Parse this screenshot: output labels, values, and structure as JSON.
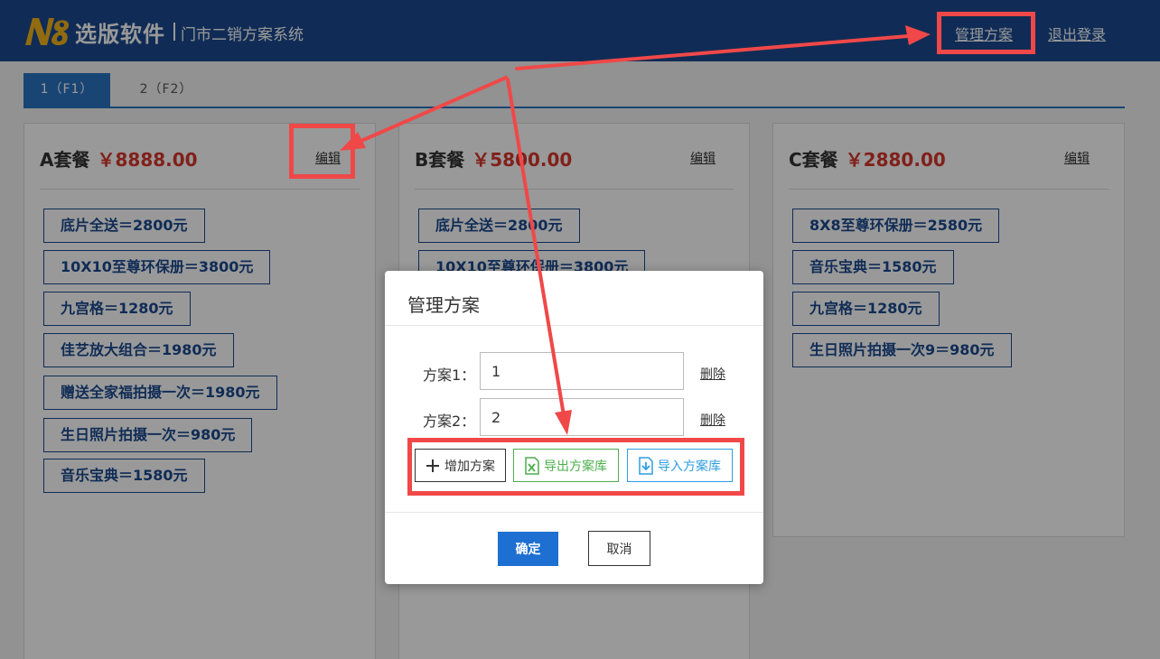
{
  "header": {
    "logo_mark": "N8",
    "title": "选版软件",
    "subtitle": "门市二销方案系统",
    "nav": {
      "manage": "管理方案",
      "logout": "退出登录"
    }
  },
  "tabs": [
    {
      "label": "1（F1）",
      "active": true
    },
    {
      "label": "2（F2）",
      "active": false
    }
  ],
  "cards": [
    {
      "name": "A套餐",
      "price": "￥8888.00",
      "edit": "编辑",
      "items": [
        "底片全送＝2800元",
        "10X10至尊环保册＝3800元",
        "九宫格＝1280元",
        "佳艺放大组合＝1980元",
        "赠送全家福拍摄一次＝1980元",
        "生日照片拍摄一次＝980元",
        "音乐宝典＝1580元"
      ]
    },
    {
      "name": "B套餐",
      "price": "￥5800.00",
      "edit": "编辑",
      "items": [
        "底片全送＝2800元",
        "10X10至尊环保册＝3800元"
      ]
    },
    {
      "name": "C套餐",
      "price": "￥2880.00",
      "edit": "编辑",
      "items": [
        "8X8至尊环保册＝2580元",
        "音乐宝典＝1580元",
        "九宫格＝1280元",
        "生日照片拍摄一次9＝980元"
      ]
    }
  ],
  "modal": {
    "title": "管理方案",
    "rows": [
      {
        "label": "方案1：",
        "value": "1",
        "delete": "删除"
      },
      {
        "label": "方案2：",
        "value": "2",
        "delete": "删除"
      }
    ],
    "actions": {
      "add": "增加方案",
      "export": "导出方案库",
      "import": "导入方案库"
    },
    "footer": {
      "ok": "确定",
      "cancel": "取消"
    }
  },
  "colors": {
    "header_bg": "#1c4a8f",
    "accent_blue": "#2b73c2",
    "price_red": "#d7362c",
    "highlight_red": "#f04848",
    "export_green": "#4cae4c",
    "import_blue": "#2d9ee0",
    "ok_blue": "#1d6fd1"
  }
}
